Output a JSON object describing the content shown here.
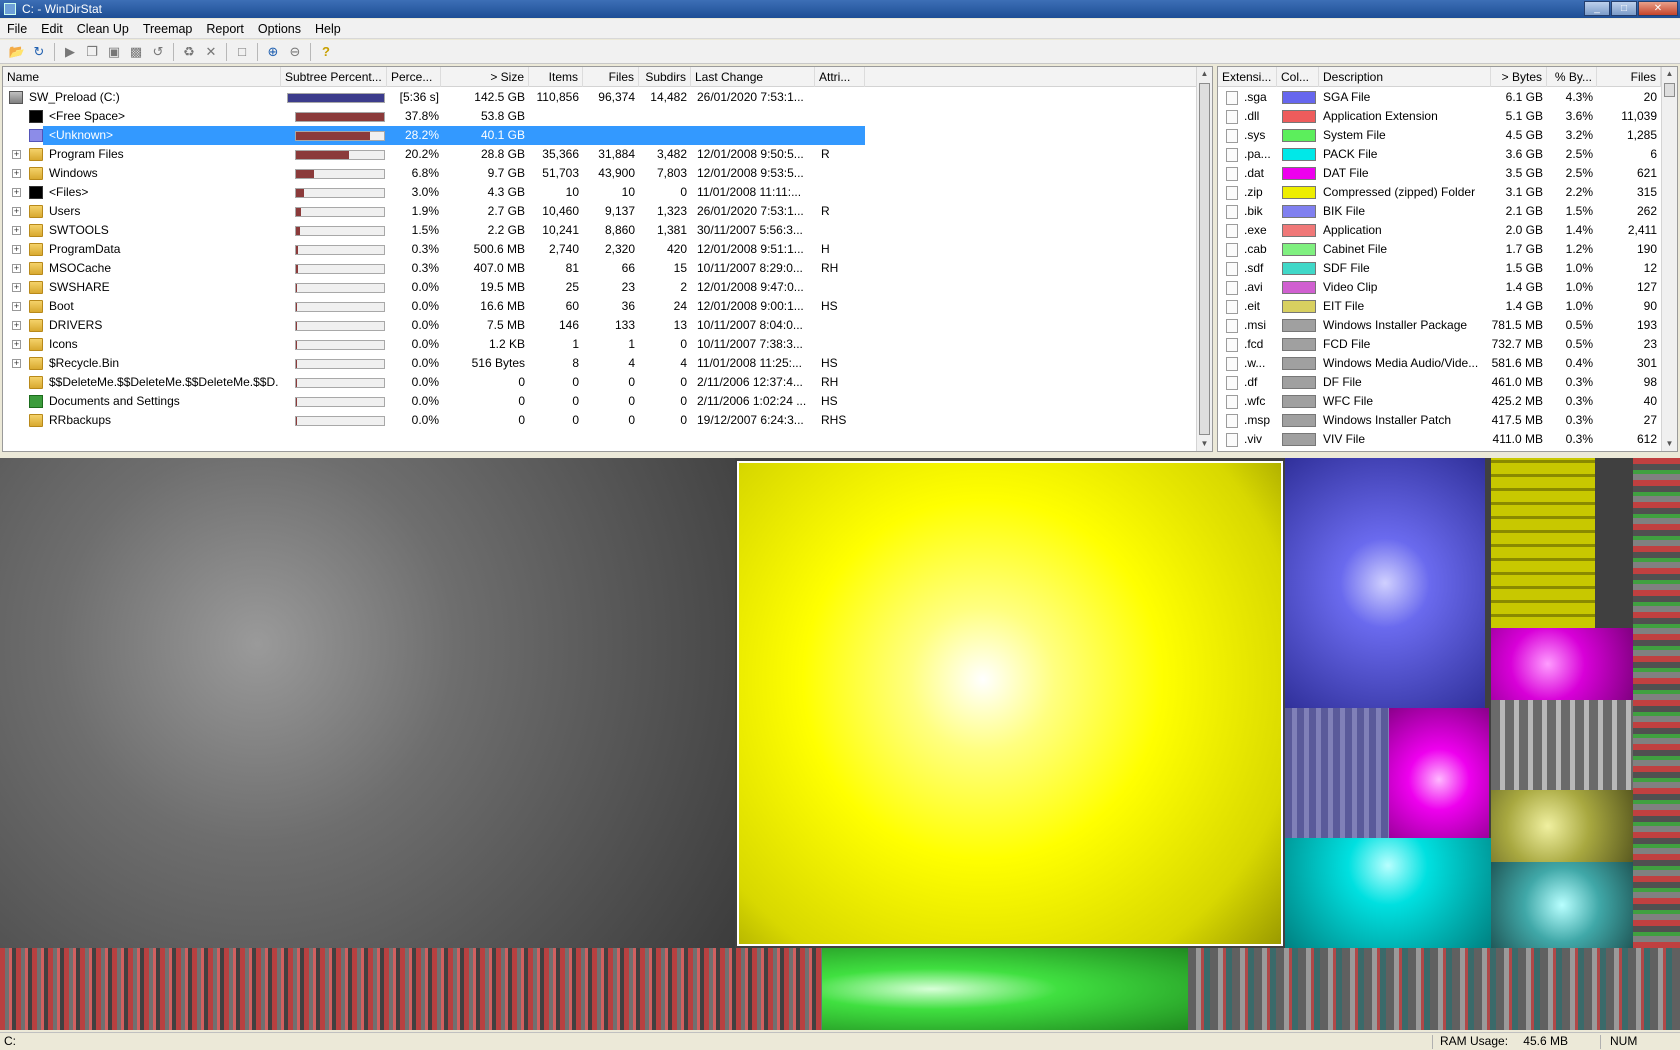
{
  "window": {
    "title": "C: - WinDirStat"
  },
  "menu": [
    "File",
    "Edit",
    "Clean Up",
    "Treemap",
    "Report",
    "Options",
    "Help"
  ],
  "tree": {
    "columns": [
      "Name",
      "Subtree Percent...",
      "Perce...",
      "> Size",
      "Items",
      "Files",
      "Subdirs",
      "Last Change",
      "Attri..."
    ],
    "rows": [
      {
        "name": "SW_Preload (C:)",
        "icon": "drive-icon",
        "expander": "",
        "bar": 1.0,
        "bar_color": "#3c3c8c",
        "percent": "[5:36 s]",
        "size": "142.5 GB",
        "items": "110,856",
        "files": "96,374",
        "subdirs": "14,482",
        "last_change": "26/01/2020 7:53:1...",
        "attr": ""
      },
      {
        "name": "<Free Space>",
        "icon": "blackbox-icon",
        "expander": "",
        "bar": 0.378,
        "bar_color": "#8b3a3a",
        "percent": "37.8%",
        "size": "53.8 GB",
        "items": "",
        "files": "",
        "subdirs": "",
        "last_change": "",
        "attr": ""
      },
      {
        "name": "<Unknown>",
        "icon": "unknown-icon",
        "expander": "",
        "bar": 0.282,
        "bar_color": "#8b3a3a",
        "percent": "28.2%",
        "size": "40.1 GB",
        "items": "",
        "files": "",
        "subdirs": "",
        "last_change": "",
        "attr": "",
        "selected": true
      },
      {
        "name": "Program Files",
        "icon": "folder-icon",
        "expander": "+",
        "bar": 0.202,
        "bar_color": "#8b3a3a",
        "percent": "20.2%",
        "size": "28.8 GB",
        "items": "35,366",
        "files": "31,884",
        "subdirs": "3,482",
        "last_change": "12/01/2008 9:50:5...",
        "attr": "R"
      },
      {
        "name": "Windows",
        "icon": "folder-icon",
        "expander": "+",
        "bar": 0.068,
        "bar_color": "#8b3a3a",
        "percent": "6.8%",
        "size": "9.7 GB",
        "items": "51,703",
        "files": "43,900",
        "subdirs": "7,803",
        "last_change": "12/01/2008 9:53:5...",
        "attr": ""
      },
      {
        "name": "<Files>",
        "icon": "blackbox-icon",
        "expander": "+",
        "bar": 0.03,
        "bar_color": "#8b3a3a",
        "percent": "3.0%",
        "size": "4.3 GB",
        "items": "10",
        "files": "10",
        "subdirs": "0",
        "last_change": "11/01/2008 11:11:...",
        "attr": ""
      },
      {
        "name": "Users",
        "icon": "folder-icon",
        "expander": "+",
        "bar": 0.019,
        "bar_color": "#8b3a3a",
        "percent": "1.9%",
        "size": "2.7 GB",
        "items": "10,460",
        "files": "9,137",
        "subdirs": "1,323",
        "last_change": "26/01/2020 7:53:1...",
        "attr": "R"
      },
      {
        "name": "SWTOOLS",
        "icon": "folder-icon",
        "expander": "+",
        "bar": 0.015,
        "bar_color": "#8b3a3a",
        "percent": "1.5%",
        "size": "2.2 GB",
        "items": "10,241",
        "files": "8,860",
        "subdirs": "1,381",
        "last_change": "30/11/2007 5:56:3...",
        "attr": ""
      },
      {
        "name": "ProgramData",
        "icon": "folder-icon",
        "expander": "+",
        "bar": 0.003,
        "bar_color": "#8b3a3a",
        "percent": "0.3%",
        "size": "500.6 MB",
        "items": "2,740",
        "files": "2,320",
        "subdirs": "420",
        "last_change": "12/01/2008 9:51:1...",
        "attr": "H"
      },
      {
        "name": "MSOCache",
        "icon": "folder-icon",
        "expander": "+",
        "bar": 0.003,
        "bar_color": "#8b3a3a",
        "percent": "0.3%",
        "size": "407.0 MB",
        "items": "81",
        "files": "66",
        "subdirs": "15",
        "last_change": "10/11/2007 8:29:0...",
        "attr": "RH"
      },
      {
        "name": "SWSHARE",
        "icon": "folder-icon",
        "expander": "+",
        "bar": 0.0,
        "bar_color": "#8b3a3a",
        "percent": "0.0%",
        "size": "19.5 MB",
        "items": "25",
        "files": "23",
        "subdirs": "2",
        "last_change": "12/01/2008 9:47:0...",
        "attr": ""
      },
      {
        "name": "Boot",
        "icon": "folder-icon",
        "expander": "+",
        "bar": 0.0,
        "bar_color": "#8b3a3a",
        "percent": "0.0%",
        "size": "16.6 MB",
        "items": "60",
        "files": "36",
        "subdirs": "24",
        "last_change": "12/01/2008 9:00:1...",
        "attr": "HS"
      },
      {
        "name": "DRIVERS",
        "icon": "folder-icon",
        "expander": "+",
        "bar": 0.0,
        "bar_color": "#8b3a3a",
        "percent": "0.0%",
        "size": "7.5 MB",
        "items": "146",
        "files": "133",
        "subdirs": "13",
        "last_change": "10/11/2007 8:04:0...",
        "attr": ""
      },
      {
        "name": "Icons",
        "icon": "folder-icon",
        "expander": "+",
        "bar": 0.0,
        "bar_color": "#8b3a3a",
        "percent": "0.0%",
        "size": "1.2 KB",
        "items": "1",
        "files": "1",
        "subdirs": "0",
        "last_change": "10/11/2007 7:38:3...",
        "attr": ""
      },
      {
        "name": "$Recycle.Bin",
        "icon": "folder-icon",
        "expander": "+",
        "bar": 0.0,
        "bar_color": "#8b3a3a",
        "percent": "0.0%",
        "size": "516 Bytes",
        "items": "8",
        "files": "4",
        "subdirs": "4",
        "last_change": "11/01/2008 11:25:...",
        "attr": "HS"
      },
      {
        "name": "$$DeleteMe.$$DeleteMe.$$DeleteMe.$$D...",
        "icon": "folder-icon",
        "expander": "",
        "bar": 0.0,
        "bar_color": "#8b3a3a",
        "percent": "0.0%",
        "size": "0",
        "items": "0",
        "files": "0",
        "subdirs": "0",
        "last_change": "2/11/2006 12:37:4...",
        "attr": "RH"
      },
      {
        "name": "Documents and Settings",
        "icon": "green-folder-icon",
        "expander": "",
        "bar": 0.0,
        "bar_color": "#8b3a3a",
        "percent": "0.0%",
        "size": "0",
        "items": "0",
        "files": "0",
        "subdirs": "0",
        "last_change": "2/11/2006 1:02:24 ...",
        "attr": "HS"
      },
      {
        "name": "RRbackups",
        "icon": "folder-icon",
        "expander": "",
        "bar": 0.0,
        "bar_color": "#8b3a3a",
        "percent": "0.0%",
        "size": "0",
        "items": "0",
        "files": "0",
        "subdirs": "0",
        "last_change": "19/12/2007 6:24:3...",
        "attr": "RHS"
      }
    ]
  },
  "extensions": {
    "columns": [
      "Extensi...",
      "Col...",
      "Description",
      "> Bytes",
      "% By...",
      "Files"
    ],
    "rows": [
      {
        "ext": ".sga",
        "color": "#6666ee",
        "desc": "SGA File",
        "bytes": "6.1 GB",
        "pct": "4.3%",
        "files": "20"
      },
      {
        "ext": ".dll",
        "color": "#ee5c5c",
        "desc": "Application Extension",
        "bytes": "5.1 GB",
        "pct": "3.6%",
        "files": "11,039"
      },
      {
        "ext": ".sys",
        "color": "#5cee5c",
        "desc": "System File",
        "bytes": "4.5 GB",
        "pct": "3.2%",
        "files": "1,285"
      },
      {
        "ext": ".pa...",
        "color": "#00e8e8",
        "desc": "PACK File",
        "bytes": "3.6 GB",
        "pct": "2.5%",
        "files": "6"
      },
      {
        "ext": ".dat",
        "color": "#ee00ee",
        "desc": "DAT File",
        "bytes": "3.5 GB",
        "pct": "2.5%",
        "files": "621"
      },
      {
        "ext": ".zip",
        "color": "#eeee00",
        "desc": "Compressed (zipped) Folder",
        "bytes": "3.1 GB",
        "pct": "2.2%",
        "files": "315"
      },
      {
        "ext": ".bik",
        "color": "#8080f0",
        "desc": "BIK File",
        "bytes": "2.1 GB",
        "pct": "1.5%",
        "files": "262"
      },
      {
        "ext": ".exe",
        "color": "#f07878",
        "desc": "Application",
        "bytes": "2.0 GB",
        "pct": "1.4%",
        "files": "2,411"
      },
      {
        "ext": ".cab",
        "color": "#80f080",
        "desc": "Cabinet File",
        "bytes": "1.7 GB",
        "pct": "1.2%",
        "files": "190"
      },
      {
        "ext": ".sdf",
        "color": "#40d8c8",
        "desc": "SDF File",
        "bytes": "1.5 GB",
        "pct": "1.0%",
        "files": "12"
      },
      {
        "ext": ".avi",
        "color": "#d060d0",
        "desc": "Video Clip",
        "bytes": "1.4 GB",
        "pct": "1.0%",
        "files": "127"
      },
      {
        "ext": ".eit",
        "color": "#d8d060",
        "desc": "EIT File",
        "bytes": "1.4 GB",
        "pct": "1.0%",
        "files": "90"
      },
      {
        "ext": ".msi",
        "color": "#a0a0a0",
        "desc": "Windows Installer Package",
        "bytes": "781.5 MB",
        "pct": "0.5%",
        "files": "193"
      },
      {
        "ext": ".fcd",
        "color": "#a0a0a0",
        "desc": "FCD File",
        "bytes": "732.7 MB",
        "pct": "0.5%",
        "files": "23"
      },
      {
        "ext": ".w...",
        "color": "#a0a0a0",
        "desc": "Windows Media Audio/Vide...",
        "bytes": "581.6 MB",
        "pct": "0.4%",
        "files": "301"
      },
      {
        "ext": ".df",
        "color": "#a0a0a0",
        "desc": "DF File",
        "bytes": "461.0 MB",
        "pct": "0.3%",
        "files": "98"
      },
      {
        "ext": ".wfc",
        "color": "#a0a0a0",
        "desc": "WFC File",
        "bytes": "425.2 MB",
        "pct": "0.3%",
        "files": "40"
      },
      {
        "ext": ".msp",
        "color": "#a0a0a0",
        "desc": "Windows Installer Patch",
        "bytes": "417.5 MB",
        "pct": "0.3%",
        "files": "27"
      },
      {
        "ext": ".viv",
        "color": "#a0a0a0",
        "desc": "VIV File",
        "bytes": "411.0 MB",
        "pct": "0.3%",
        "files": "612"
      }
    ]
  },
  "status": {
    "left": "C:",
    "ram_label": "RAM Usage:",
    "ram_value": "45.6 MB",
    "num": "NUM"
  },
  "window_buttons": {
    "minimize": "_",
    "maximize": "□",
    "close": "✕"
  }
}
